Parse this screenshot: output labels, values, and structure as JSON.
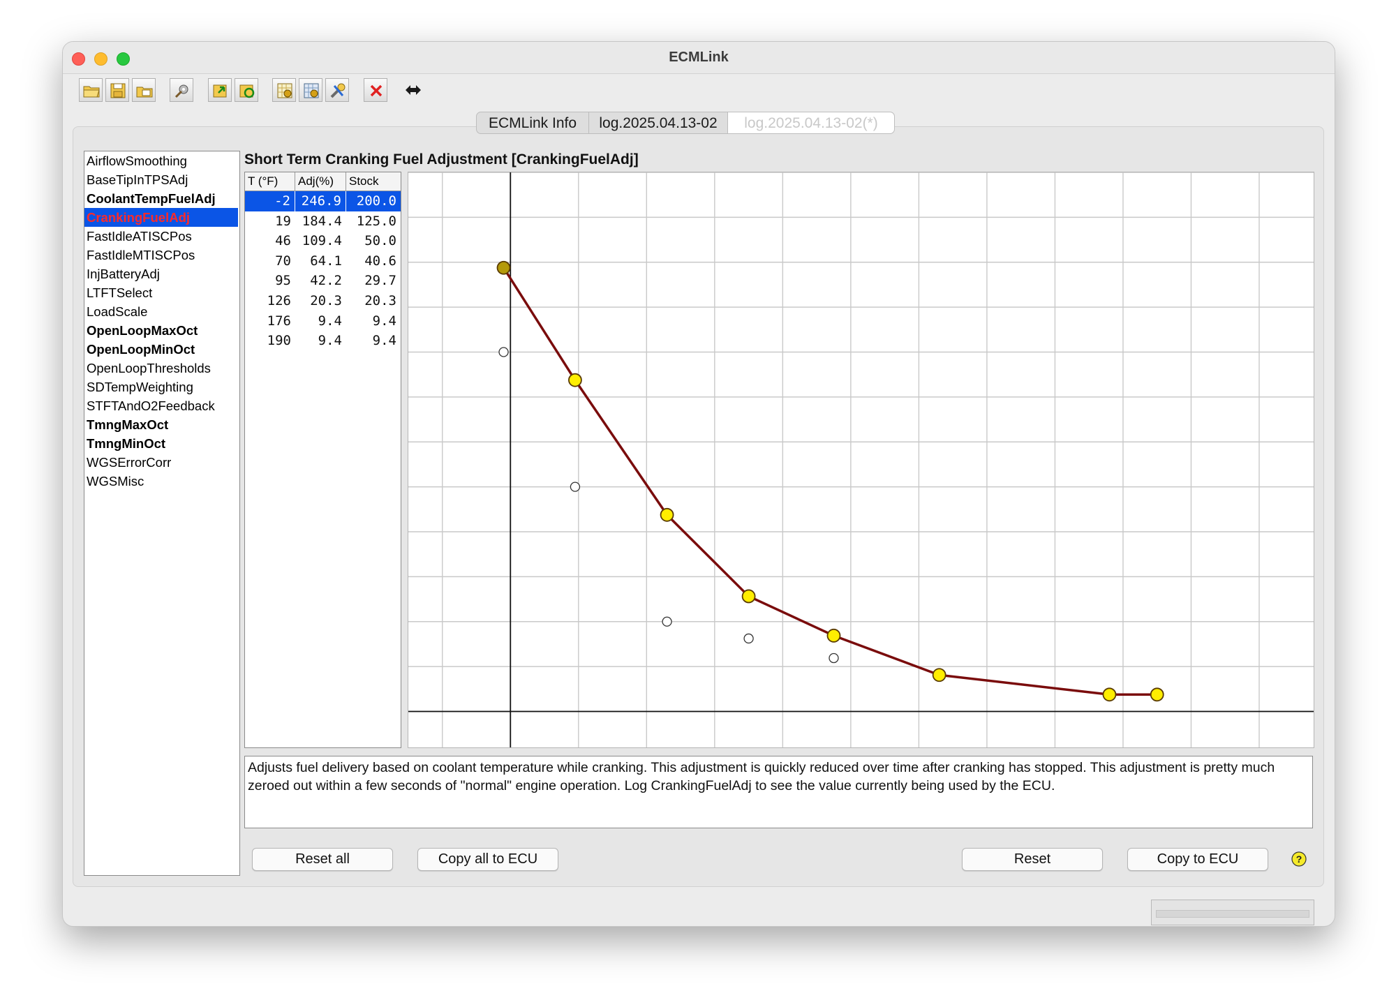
{
  "window": {
    "title": "ECMLink"
  },
  "toolbar": {
    "buttons": [
      {
        "icon": "open-folder-icon"
      },
      {
        "icon": "save-icon"
      },
      {
        "icon": "save-as-icon"
      },
      {
        "icon": "tools-icon"
      },
      {
        "icon": "load-map-icon"
      },
      {
        "icon": "refresh-icon"
      },
      {
        "icon": "chart-settings-icon"
      },
      {
        "icon": "grid-settings-icon"
      },
      {
        "icon": "wrench-icon"
      },
      {
        "icon": "close-red-x-icon"
      },
      {
        "icon": "double-arrow-icon"
      }
    ]
  },
  "tabs": [
    {
      "label": "ECMLink Info"
    },
    {
      "label": "log.2025.04.13-02"
    },
    {
      "label": "log.2025.04.13-02(*)"
    }
  ],
  "sidebar": {
    "items": [
      {
        "label": "AirflowSmoothing"
      },
      {
        "label": "BaseTipInTPSAdj"
      },
      {
        "label": "CoolantTempFuelAdj"
      },
      {
        "label": "CrankingFuelAdj"
      },
      {
        "label": "FastIdleATISCPos"
      },
      {
        "label": "FastIdleMTISCPos"
      },
      {
        "label": "InjBatteryAdj"
      },
      {
        "label": "LTFTSelect"
      },
      {
        "label": "LoadScale"
      },
      {
        "label": "OpenLoopMaxOct"
      },
      {
        "label": "OpenLoopMinOct"
      },
      {
        "label": "OpenLoopThresholds"
      },
      {
        "label": "SDTempWeighting"
      },
      {
        "label": "STFTAndO2Feedback"
      },
      {
        "label": "TmngMaxOct"
      },
      {
        "label": "TmngMinOct"
      },
      {
        "label": "WGSErrorCorr"
      },
      {
        "label": "WGSMisc"
      }
    ]
  },
  "map": {
    "title": "Short Term Cranking Fuel Adjustment [CrankingFuelAdj]",
    "columns": [
      "T (°F)",
      "Adj(%)",
      "Stock"
    ],
    "rows": [
      [
        "-2",
        "246.9",
        "200.0"
      ],
      [
        "19",
        "184.4",
        "125.0"
      ],
      [
        "46",
        "109.4",
        "50.0"
      ],
      [
        "70",
        "64.1",
        "40.6"
      ],
      [
        "95",
        "42.2",
        "29.7"
      ],
      [
        "126",
        "20.3",
        "20.3"
      ],
      [
        "176",
        "9.4",
        "9.4"
      ],
      [
        "190",
        "9.4",
        "9.4"
      ]
    ]
  },
  "description": "Adjusts fuel delivery based on coolant temperature while cranking.  This adjustment is quickly reduced over time after cranking has stopped.  This adjustment is pretty much zeroed out within a few seconds of \"normal\" engine operation.  Log CrankingFuelAdj to see the value currently being used by the ECU.",
  "buttons": {
    "reset_all": "Reset all",
    "copy_all": "Copy all to ECU",
    "reset": "Reset",
    "copy": "Copy to ECU"
  },
  "colors": {
    "line": "#7a0c0c",
    "point_fill": "#ffee00",
    "selected_point_fill": "#b49a0a",
    "stock_point_fill": "#ffffff",
    "selection": "#0b55e6",
    "selected_label_text": "#ff2a2a"
  },
  "chart_data": {
    "type": "line",
    "x": [
      -2,
      19,
      46,
      70,
      95,
      126,
      176,
      190
    ],
    "series": [
      {
        "values": [
          246.9,
          184.4,
          109.4,
          64.1,
          42.2,
          20.3,
          9.4,
          9.4
        ],
        "markers": "filled"
      },
      {
        "values": [
          200.0,
          125.0,
          50.0,
          40.6,
          29.7,
          20.3,
          9.4,
          9.4
        ],
        "markers": "hollow"
      }
    ],
    "selected_index": 0,
    "grid": true
  }
}
